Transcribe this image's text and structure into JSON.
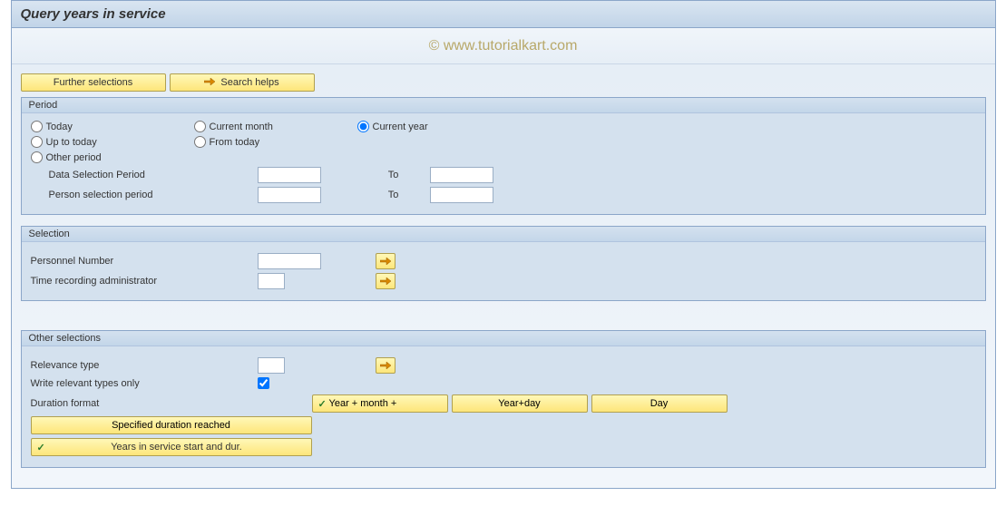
{
  "title": "Query years in service",
  "watermark": "© www.tutorialkart.com",
  "toolbar": {
    "further_selections": "Further selections",
    "search_helps": "Search helps"
  },
  "period": {
    "group_label": "Period",
    "today": "Today",
    "current_month": "Current month",
    "current_year": "Current year",
    "up_to_today": "Up to today",
    "from_today": "From today",
    "other_period": "Other period",
    "data_selection_period": "Data Selection Period",
    "person_selection_period": "Person selection period",
    "to_label": "To",
    "selected": "current_year"
  },
  "selection": {
    "group_label": "Selection",
    "personnel_number": "Personnel Number",
    "time_recording_admin": "Time recording administrator"
  },
  "other": {
    "group_label": "Other selections",
    "relevance_type": "Relevance type",
    "write_relevant_only": "Write relevant types only",
    "write_relevant_only_checked": true,
    "duration_format": "Duration format",
    "year_month": "Year + month +",
    "year_day": "Year+day",
    "day": "Day",
    "specified_duration": "Specified duration reached",
    "years_in_service": "Years in service start and dur."
  }
}
